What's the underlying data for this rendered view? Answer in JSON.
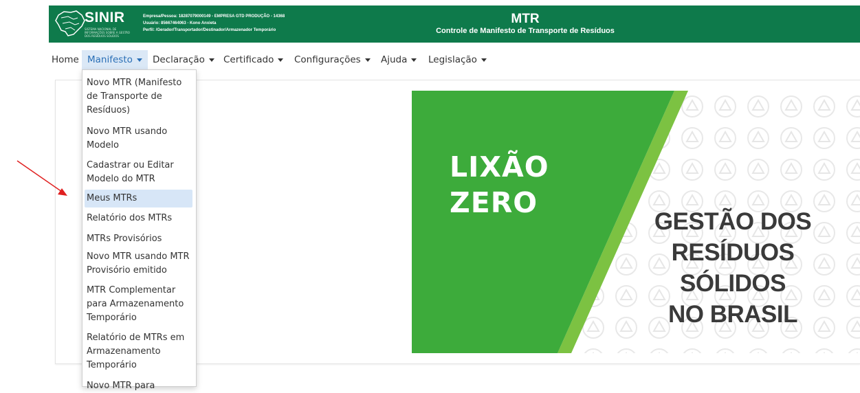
{
  "header": {
    "logo_text": "SINIR",
    "logo_subtitle": "SISTEMA NACIONAL DE INFORMAÇÕES SOBRE A GESTÃO DOS RESÍDUOS SÓLIDOS",
    "empresa": "Empresa/Pessoa: 18287079000149 - EMPRESA GTD PRODUÇÃO - 14368",
    "usuario": "Usuário: 85667464063 - Kono Anxieta",
    "perfil": "Perfil: /Gerador/Transportador/Destinador/Armazenador Temporário",
    "title": "MTR",
    "subtitle": "Controle de Manifesto de Transporte de Resíduos"
  },
  "nav": {
    "home": "Home",
    "manifesto": "Manifesto",
    "declaracao": "Declaração",
    "certificado": "Certificado",
    "configuracoes": "Configurações",
    "ajuda": "Ajuda",
    "legislacao": "Legislação"
  },
  "dropdown": {
    "items": [
      {
        "label": "Novo MTR (Manifesto de Transporte de Resíduos)"
      },
      {
        "label": "Novo MTR usando Modelo"
      },
      {
        "label": "Cadastrar ou Editar Modelo do MTR"
      },
      {
        "label": "Meus MTRs"
      },
      {
        "label": "Relatório dos MTRs"
      },
      {
        "label": "MTRs Provisórios"
      },
      {
        "label": "Novo MTR usando MTR Provisório emitido"
      },
      {
        "label": "MTR Complementar para Armazenamento Temporário"
      },
      {
        "label": "Relatório de MTRs em Armazenamento Temporário"
      },
      {
        "label": "Novo MTR para"
      }
    ]
  },
  "banner": {
    "line1": "LIXÃO",
    "line2": "ZERO",
    "gestao1": "GESTÃO DOS",
    "gestao2": "RESÍDUOS",
    "gestao3": "SÓLIDOS",
    "gestao4": "NO BRASIL"
  },
  "colors": {
    "header_bg": "#0e7a4b",
    "banner_green": "#3dab3b",
    "banner_stripe": "#7cc242",
    "highlight": "#d7e6f7",
    "arrow": "#e02020"
  }
}
